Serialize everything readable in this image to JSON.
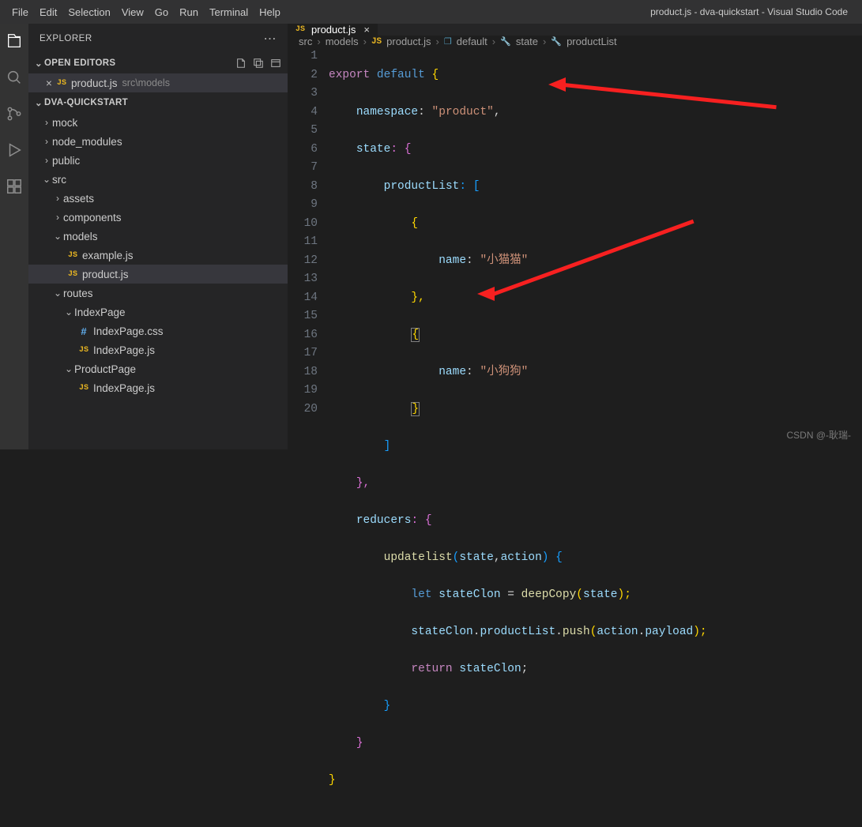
{
  "window_title": "product.js - dva-quickstart - Visual Studio Code",
  "menu": [
    "File",
    "Edit",
    "Selection",
    "View",
    "Go",
    "Run",
    "Terminal",
    "Help"
  ],
  "sidebar": {
    "title": "EXPLORER",
    "open_editors_label": "OPEN EDITORS",
    "project_label": "DVA-QUICKSTART",
    "open_editor": {
      "file": "product.js",
      "path": "src\\models"
    },
    "tree": {
      "mock": "mock",
      "node_modules": "node_modules",
      "public": "public",
      "src": "src",
      "assets": "assets",
      "components": "components",
      "models": "models",
      "example": "example.js",
      "product": "product.js",
      "routes": "routes",
      "indexpage": "IndexPage",
      "indexpagecss": "IndexPage.css",
      "indexpagejs": "IndexPage.js",
      "productpage": "ProductPage",
      "indexpagejs2": "IndexPage.js"
    }
  },
  "tab": {
    "file": "product.js"
  },
  "breadcrumbs": {
    "p1": "src",
    "p2": "models",
    "p3": "product.js",
    "p4": "default",
    "p5": "state",
    "p6": "productList"
  },
  "code": {
    "l1a": "export",
    "l1b": "default",
    "l1c": " {",
    "l2a": "namespace",
    "l2b": ": ",
    "l2c": "\"product\"",
    "l2d": ",",
    "l3a": "state",
    "l3b": ": {",
    "l4a": "productList",
    "l4b": ": [",
    "l5a": "{",
    "l6a": "name",
    "l6b": ": ",
    "l6c": "\"小猫猫\"",
    "l7a": "},",
    "l8a": "{",
    "l9a": "name",
    "l9b": ": ",
    "l9c": "\"小狗狗\"",
    "l10a": "}",
    "l11a": "]",
    "l12a": "},",
    "l13a": "reducers",
    "l13b": ": {",
    "l14a": "updatelist",
    "l14b": "(",
    "l14c": "state",
    "l14d": ",",
    "l14e": "action",
    "l14f": ") {",
    "l15a": "let",
    "l15b": " ",
    "l15c": "stateClon",
    "l15d": " = ",
    "l15e": "deepCopy",
    "l15f": "(",
    "l15g": "state",
    "l15h": ");",
    "l16a": "stateClon",
    "l16b": ".",
    "l16c": "productList",
    "l16d": ".",
    "l16e": "push",
    "l16f": "(",
    "l16g": "action",
    "l16h": ".",
    "l16i": "payload",
    "l16j": ");",
    "l17a": "return",
    "l17b": " ",
    "l17c": "stateClon",
    "l17d": ";",
    "l18a": "}",
    "l19a": "}",
    "l20a": "}"
  },
  "line_numbers": [
    "1",
    "2",
    "3",
    "4",
    "5",
    "6",
    "7",
    "8",
    "9",
    "10",
    "11",
    "12",
    "13",
    "14",
    "15",
    "16",
    "17",
    "18",
    "19",
    "20"
  ],
  "watermark": "CSDN @-耿瑞-"
}
